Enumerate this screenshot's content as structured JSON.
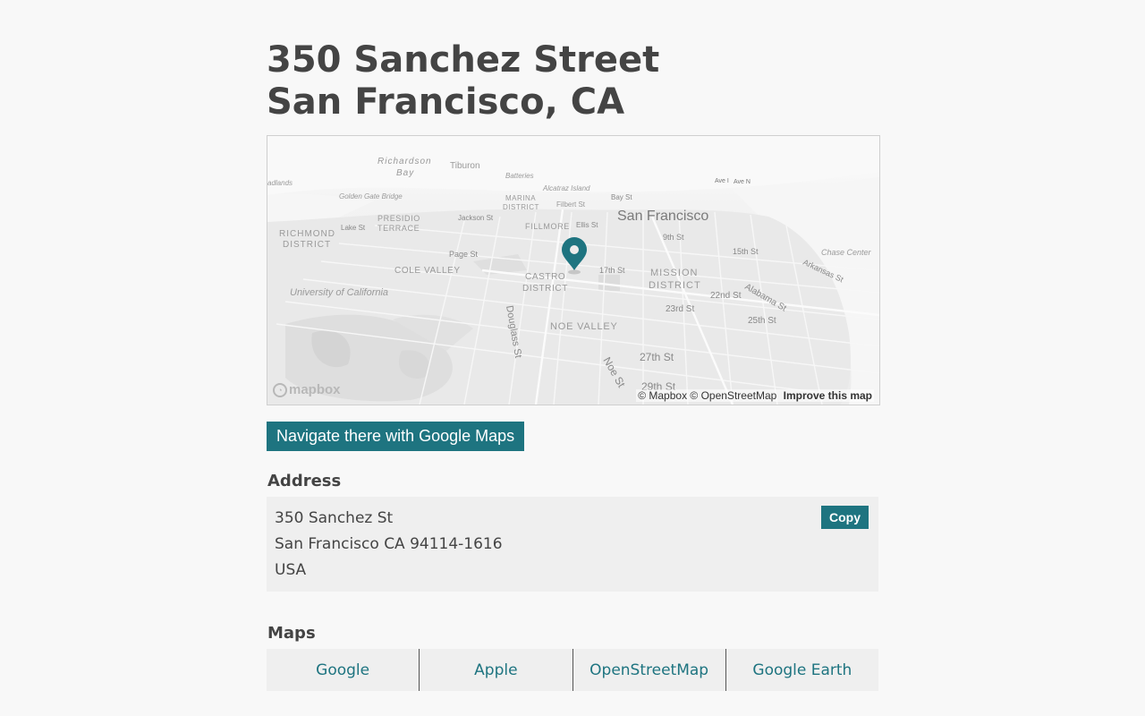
{
  "header": {
    "title_line1": "350 Sanchez Street",
    "title_line2": "San Francisco, CA"
  },
  "map": {
    "labels": {
      "richardson1": "Richardson",
      "richardson2": "Bay",
      "tiburon": "Tiburon",
      "batteries": "Batteries",
      "highlands": "adlands",
      "golden_gate": "Golden Gate Bridge",
      "alcatraz": "Alcatraz Island",
      "marina1": "MARINA",
      "marina2": "DISTRICT",
      "filbert": "Filbert St",
      "bay_st": "Bay St",
      "ave_i": "Ave I",
      "ave_n": "Ave N",
      "presidio1": "PRESIDIO",
      "presidio2": "TERRACE",
      "jackson": "Jackson St",
      "fillmore": "FILLMORE",
      "ellis": "Ellis St",
      "sf": "San Francisco",
      "richmond1": "RICHMOND",
      "richmond2": "DISTRICT",
      "lake_st": "Lake St",
      "ninth": "9th St",
      "page_st": "Page St",
      "fifteenth": "15th St",
      "chase": "Chase Center",
      "arkansas": "Arkansas St",
      "cole_valley": "COLE VALLEY",
      "castro1": "CASTRO",
      "castro2": "DISTRICT",
      "seventeenth": "17th St",
      "mission1": "MISSION",
      "mission2": "DISTRICT",
      "ucsf": "University of California",
      "twentysecond": "22nd St",
      "alabama": "Alabama St",
      "twentythird": "23rd St",
      "twentyfifth": "25th St",
      "douglass": "Douglass St",
      "noe_valley": "NOE VALLEY",
      "twentyseventh": "27th St",
      "noe_st": "Noe St",
      "twentyninth": "29th St"
    },
    "logo_text": "mapbox",
    "attribution": "© Mapbox © OpenStreetMap",
    "improve": "Improve this map"
  },
  "navigate_label": "Navigate there with Google Maps",
  "address": {
    "label": "Address",
    "line1": "350 Sanchez St",
    "line2": "San Francisco CA 94114-1616",
    "line3": "USA",
    "copy_label": "Copy"
  },
  "maps": {
    "label": "Maps",
    "links": [
      "Google",
      "Apple",
      "OpenStreetMap",
      "Google Earth"
    ]
  },
  "colors": {
    "accent": "#1e7480",
    "background": "#f8f8f8",
    "panel": "#efefef"
  }
}
